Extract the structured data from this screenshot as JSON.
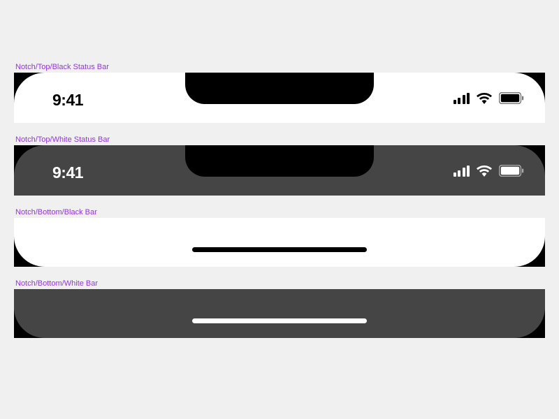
{
  "components": {
    "top_black": {
      "label": "Notch/Top/Black Status Bar",
      "time": "9:41",
      "colors": {
        "surface": "#ffffff",
        "content": "#000000",
        "frame": "#000000"
      }
    },
    "top_white": {
      "label": "Notch/Top/White Status Bar",
      "time": "9:41",
      "colors": {
        "surface": "#454545",
        "content": "#ffffff",
        "frame": "#000000"
      }
    },
    "bottom_black": {
      "label": "Notch/Bottom/Black Bar",
      "colors": {
        "surface": "#ffffff",
        "indicator": "#000000",
        "frame": "#000000"
      }
    },
    "bottom_white": {
      "label": "Notch/Bottom/White Bar",
      "colors": {
        "surface": "#454545",
        "indicator": "#ffffff",
        "frame": "#000000"
      }
    }
  },
  "icons": {
    "cellular": "cellular-icon",
    "wifi": "wifi-icon",
    "battery": "battery-icon"
  }
}
